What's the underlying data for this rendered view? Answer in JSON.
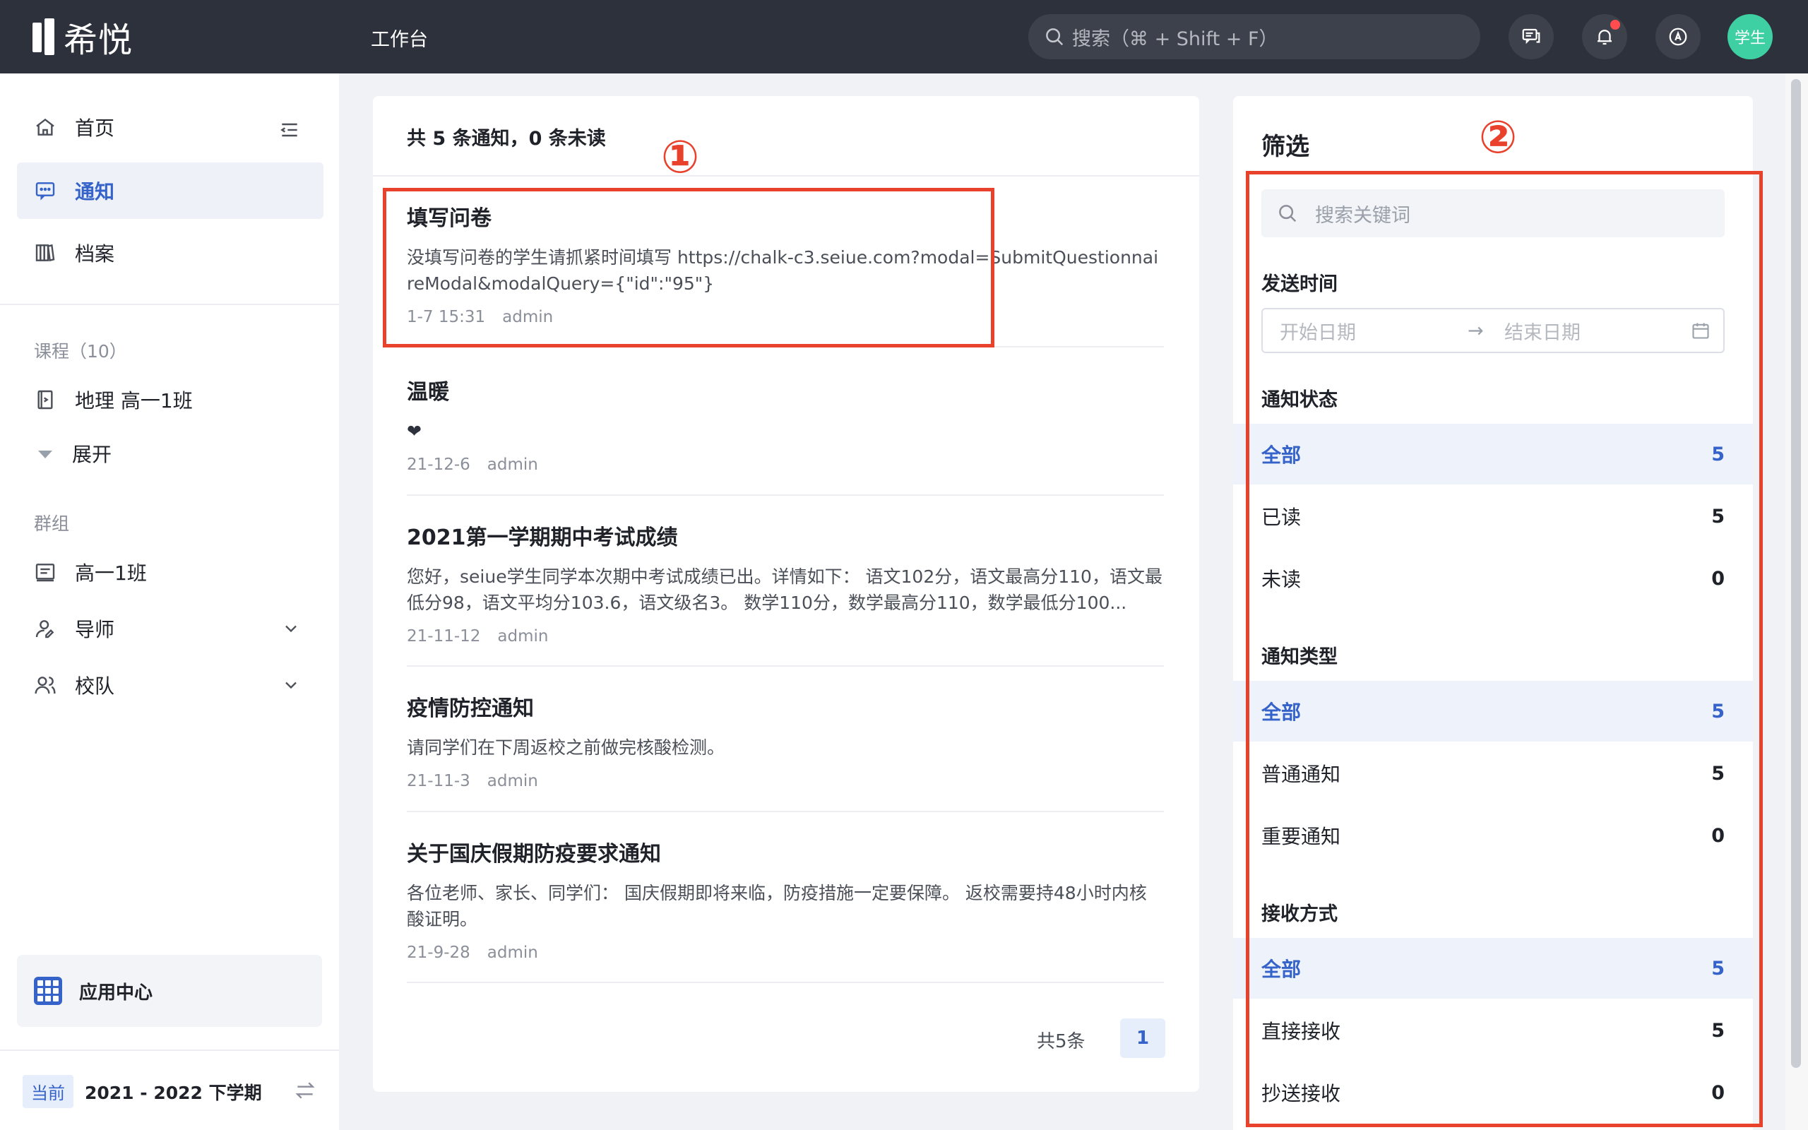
{
  "app": {
    "logo_text": "希悦",
    "workspace_title": "工作台"
  },
  "topbar": {
    "search_placeholder": "搜索（⌘ + Shift + F）",
    "avatar_label": "学生"
  },
  "sidebar": {
    "items": [
      {
        "label": "首页"
      },
      {
        "label": "通知"
      },
      {
        "label": "档案"
      }
    ],
    "courses_group": "课程（10）",
    "course_item": "地理 高一1班",
    "expand_label": "展开",
    "groups_group": "群组",
    "group_items": [
      {
        "label": "高一1班"
      },
      {
        "label": "导师"
      },
      {
        "label": "校队"
      }
    ],
    "app_center": "应用中心",
    "semester_tag": "当前",
    "semester_text": "2021 - 2022 下学期"
  },
  "list": {
    "summary": "共 5 条通知，0 条未读",
    "notices": [
      {
        "title": "填写问卷",
        "body": "没填写问卷的学生请抓紧时间填写 https://chalk-c3.seiue.com?modal=SubmitQuestionnaireModal&modalQuery={\"id\":\"95\"}",
        "date": "1-7 15:31",
        "author": "admin"
      },
      {
        "title": "温暖",
        "body": "❤",
        "date": "21-12-6",
        "author": "admin"
      },
      {
        "title": "2021第一学期期中考试成绩",
        "body": "您好，seiue学生同学本次期中考试成绩已出。详情如下： 语文102分，语文最高分110，语文最低分98，语文平均分103.6，语文级名3。 数学110分，数学最高分110，数学最低分100...",
        "date": "21-11-12",
        "author": "admin"
      },
      {
        "title": "疫情防控通知",
        "body": "请同学们在下周返校之前做完核酸检测。",
        "date": "21-11-3",
        "author": "admin"
      },
      {
        "title": "关于国庆假期防疫要求通知",
        "body": "各位老师、家长、同学们： 国庆假期即将来临，防疫措施一定要保障。 返校需要持48小时内核酸证明。",
        "date": "21-9-28",
        "author": "admin"
      }
    ],
    "pager_total": "共5条",
    "pager_page": "1"
  },
  "filter": {
    "title": "筛选",
    "keyword_placeholder": "搜索关键词",
    "send_time_label": "发送时间",
    "date_start": "开始日期",
    "date_arrow": "→",
    "date_end": "结束日期",
    "status_label": "通知状态",
    "status_options": [
      {
        "label": "全部",
        "count": "5"
      },
      {
        "label": "已读",
        "count": "5"
      },
      {
        "label": "未读",
        "count": "0"
      }
    ],
    "type_label": "通知类型",
    "type_options": [
      {
        "label": "全部",
        "count": "5"
      },
      {
        "label": "普通通知",
        "count": "5"
      },
      {
        "label": "重要通知",
        "count": "0"
      }
    ],
    "receive_label": "接收方式",
    "receive_options": [
      {
        "label": "全部",
        "count": "5"
      },
      {
        "label": "直接接收",
        "count": "5"
      },
      {
        "label": "抄送接收",
        "count": "0"
      }
    ]
  },
  "annotations": {
    "one": "①",
    "two": "②"
  },
  "colors": {
    "accent": "#3563c9",
    "topbar": "#2d313b",
    "annotation": "#e8412c"
  }
}
